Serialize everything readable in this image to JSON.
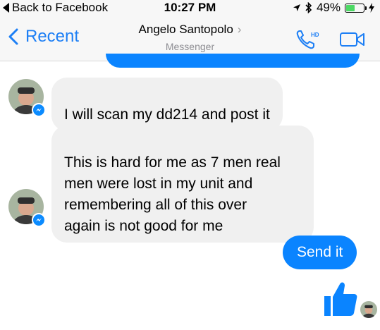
{
  "status_bar": {
    "back_label": "Back to Facebook",
    "time": "10:27 PM",
    "battery": "49%",
    "battery_level": 0.49
  },
  "header": {
    "back_label": "Recent",
    "contact_name": "Angelo Santopolo",
    "subtitle": "Messenger",
    "icons": [
      "phone-hd-icon",
      "video-icon"
    ]
  },
  "messages": [
    {
      "direction": "incoming",
      "text": "I will scan my dd214 and post it"
    },
    {
      "direction": "incoming",
      "text": "This is hard for me as 7 men real\nmen were lost in my unit and\nremembering all of this over\nagain is not good for me"
    },
    {
      "direction": "outgoing",
      "text": "Send it"
    },
    {
      "direction": "outgoing",
      "type": "like",
      "icon": "thumbs-up-icon"
    }
  ],
  "colors": {
    "accent": "#0a84ff",
    "incoming_bubble": "#f0f0f0",
    "header_bg": "#f7f7f7"
  }
}
